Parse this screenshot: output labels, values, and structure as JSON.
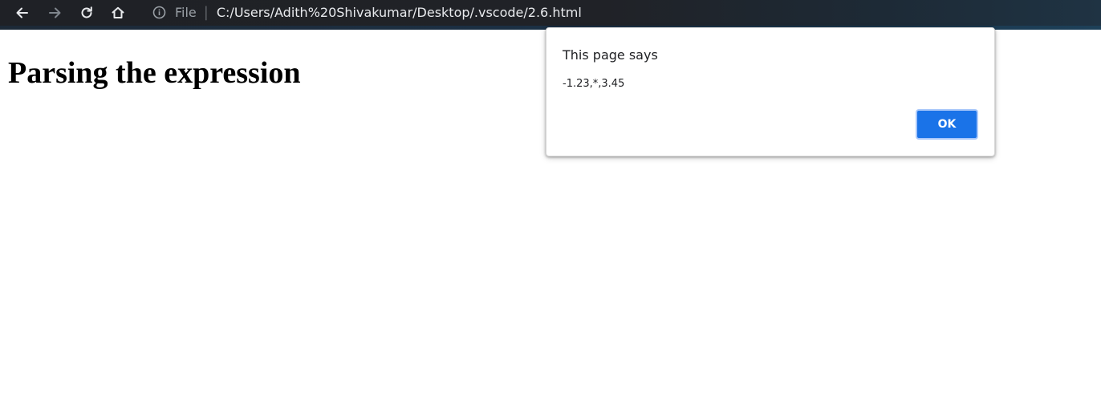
{
  "browser": {
    "nav": {
      "back_icon": "arrow-left-icon",
      "forward_icon": "arrow-right-icon",
      "reload_icon": "reload-icon",
      "home_icon": "home-icon"
    },
    "omnibox": {
      "info_icon": "info-icon",
      "scheme_label": "File",
      "separator": "|",
      "url": "C:/Users/Adith%20Shivakumar/Desktop/.vscode/2.6.html"
    }
  },
  "page": {
    "heading": "Parsing the expression"
  },
  "dialog": {
    "title": "This page says",
    "message": "-1.23,*,3.45",
    "ok_label": "OK"
  },
  "colors": {
    "toolbar_bg": "#202227",
    "accent_blue": "#1a73e8",
    "url_text": "#e8eaed",
    "muted_text": "#9aa0a6"
  }
}
